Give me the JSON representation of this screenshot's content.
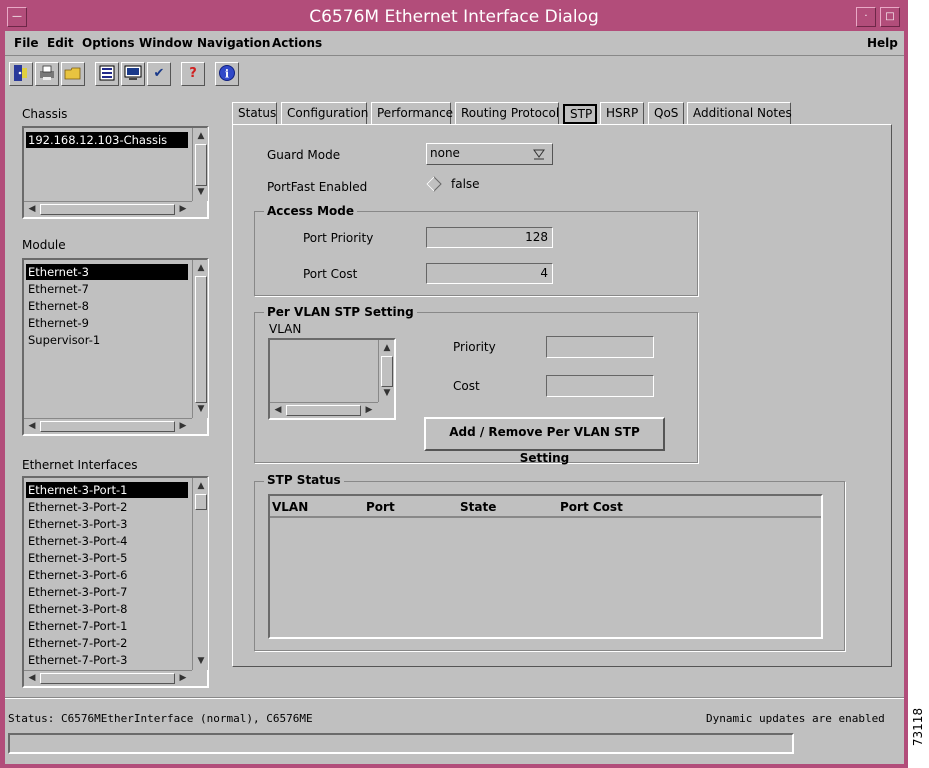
{
  "window": {
    "title": "C6576M Ethernet Interface Dialog"
  },
  "menubar": {
    "items": [
      "File",
      "Edit",
      "Options",
      "Window",
      "Navigation",
      "Actions"
    ],
    "help": "Help"
  },
  "toolbar": {
    "buttons": [
      "exit-icon",
      "print-icon",
      "open-folder-icon",
      "list-icon",
      "monitor-icon",
      "check-icon",
      "help-icon",
      "info-icon"
    ],
    "glyphs": {
      "help": "?",
      "info": "i",
      "check": "✔"
    }
  },
  "chassis": {
    "label": "Chassis",
    "items": [
      "192.168.12.103-Chassis"
    ]
  },
  "module": {
    "label": "Module",
    "items": [
      "Ethernet-3",
      "Ethernet-7",
      "Ethernet-8",
      "Ethernet-9",
      "Supervisor-1"
    ]
  },
  "interfaces": {
    "label": "Ethernet Interfaces",
    "items": [
      "Ethernet-3-Port-1",
      "Ethernet-3-Port-2",
      "Ethernet-3-Port-3",
      "Ethernet-3-Port-4",
      "Ethernet-3-Port-5",
      "Ethernet-3-Port-6",
      "Ethernet-3-Port-7",
      "Ethernet-3-Port-8",
      "Ethernet-7-Port-1",
      "Ethernet-7-Port-2",
      "Ethernet-7-Port-3"
    ]
  },
  "tabs": [
    "Status",
    "Configuration",
    "Performance",
    "Routing Protocol",
    "STP",
    "HSRP",
    "QoS",
    "Additional Notes"
  ],
  "active_tab": "STP",
  "stp": {
    "guard_mode_label": "Guard Mode",
    "guard_mode_value": "none",
    "portfast_label": "PortFast Enabled",
    "portfast_value": "false",
    "access_mode": {
      "title": "Access Mode",
      "port_priority_label": "Port Priority",
      "port_priority_value": "128",
      "port_cost_label": "Port Cost",
      "port_cost_value": "4"
    },
    "per_vlan": {
      "title": "Per VLAN STP Setting",
      "vlan_label": "VLAN",
      "priority_label": "Priority",
      "priority_value": "",
      "cost_label": "Cost",
      "cost_value": "",
      "button": "Add / Remove Per VLAN STP Setting"
    },
    "status": {
      "title": "STP Status",
      "columns": [
        "VLAN",
        "Port",
        "State",
        "Port Cost"
      ]
    }
  },
  "statusbar": {
    "left": "Status: C6576MEtherInterface (normal), C6576ME",
    "right": "Dynamic updates are enabled"
  },
  "side_label": "73118",
  "colors": {
    "frame": "#b24d7a",
    "panel": "#c0c0c0"
  }
}
